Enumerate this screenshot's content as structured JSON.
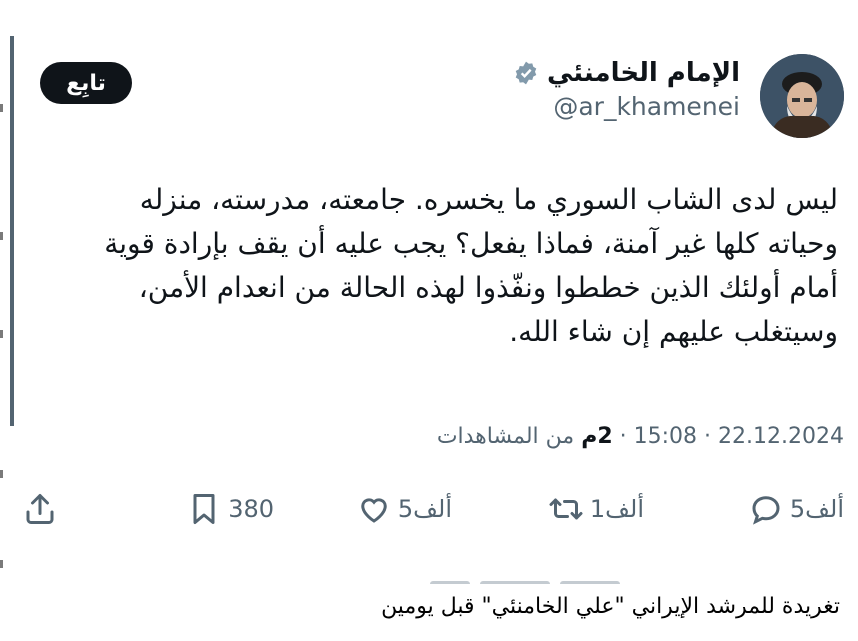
{
  "profile": {
    "display_name": "الإمام الخامنئي",
    "handle": "@ar_khamenei"
  },
  "follow_label": "تابِع",
  "tweet": {
    "lines": [
      "ليس لدى الشاب السوري ما يخسره. جامعته، مدرسته، منزله",
      "وحياته كلها غير آمنة، فماذا يفعل؟ يجب عليه أن يقف بإرادة قوية",
      "أمام أولئك الذين خططوا ونفّذوا لهذه الحالة من انعدام الأمن،",
      "وسيتغلب عليهم إن شاء الله."
    ]
  },
  "meta": {
    "date": "22.12.2024",
    "time": "15:08",
    "views_count": "2م",
    "views_label": "من المشاهدات",
    "separator": "·"
  },
  "actions": {
    "replies": "5ألف",
    "reposts": "1ألف",
    "likes": "5ألف",
    "bookmarks": "380"
  },
  "icons": [
    "verified-icon",
    "reply-icon",
    "repost-icon",
    "like-icon",
    "bookmark-icon",
    "share-icon"
  ],
  "caption": "تغريدة للمرشد الإيراني \"علي الخامنئي\" قبل يومين"
}
